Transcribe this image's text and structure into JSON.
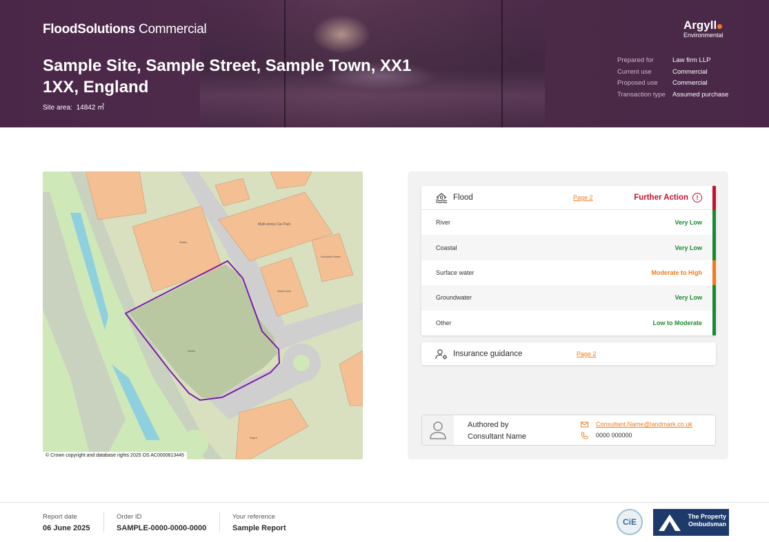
{
  "header": {
    "brand_bold": "FloodSolutions",
    "brand_light": "Commercial",
    "site_title": "Sample Site, Sample Street, Sample Town, XX1 1XX, England",
    "site_area_label": "Site area:",
    "site_area_value": "14842 ㎡",
    "logo_name": "Argyll",
    "logo_sub": "Environmental",
    "meta": [
      {
        "key": "Prepared for",
        "value": "Law firm LLP"
      },
      {
        "key": "Current use",
        "value": "Commercial"
      },
      {
        "key": "Proposed use",
        "value": "Commercial"
      },
      {
        "key": "Transaction type",
        "value": "Assumed purchase"
      }
    ]
  },
  "map": {
    "copyright": "© Crown copyright and database rights 2025 OS AC0000813445",
    "labels": [
      "Multi-storey Car Park",
      "Works",
      "Works",
      "Warehouse",
      "Industrial Estate",
      "Depot"
    ]
  },
  "flood": {
    "title": "Flood",
    "page_link": "Page 2",
    "action": "Further Action",
    "action_color": "#c8102e",
    "rows": [
      {
        "label": "River",
        "value": "Very Low",
        "color": "#1a8a2e"
      },
      {
        "label": "Coastal",
        "value": "Very Low",
        "color": "#1a8a2e"
      },
      {
        "label": "Surface water",
        "value": "Moderate to High",
        "color": "#f07c1d"
      },
      {
        "label": "Groundwater",
        "value": "Very Low",
        "color": "#1a8a2e"
      },
      {
        "label": "Other",
        "value": "Low to Moderate",
        "color": "#1a8a2e"
      }
    ]
  },
  "insurance": {
    "title": "Insurance guidance",
    "page_link": "Page 2"
  },
  "author": {
    "authored_by": "Authored by",
    "name": "Consultant Name",
    "email": "Consultant.Name@landmark.co.uk",
    "phone": "0000 000000"
  },
  "footer": {
    "report_date_label": "Report date",
    "report_date": "06 June 2025",
    "order_id_label": "Order ID",
    "order_id": "SAMPLE-0000-0000-0000",
    "reference_label": "Your reference",
    "reference": "Sample Report",
    "cie_text": "CiE",
    "tpo_text": "The Property Ombudsman"
  },
  "colors": {
    "header_bg": "#4a2748",
    "accent": "#f07c1d",
    "danger": "#c8102e",
    "ok": "#1a8a2e"
  }
}
